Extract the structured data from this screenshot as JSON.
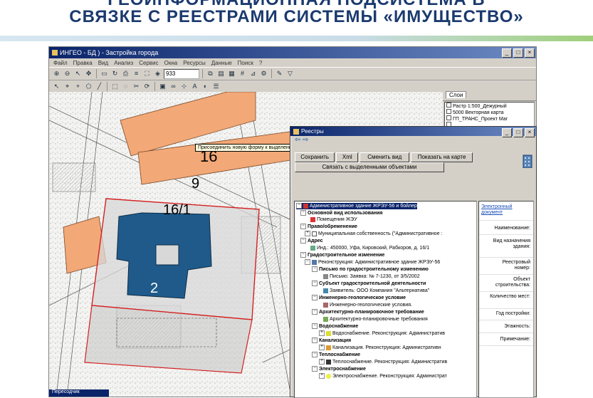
{
  "slide": {
    "title_line1": "ГЕОИНФОРМАЦИОННАЯ ПОДСИСТЕМА В",
    "title_line2": "СВЯЗКЕ С РЕЕСТРАМИ СИСТЕМЫ «ИМУЩЕСТВО»",
    "accent_color": "#1b3a6e"
  },
  "app": {
    "title": "ИНГЕО - БД                    ) - Застройка города",
    "menu": [
      "Файл",
      "Правка",
      "Вид",
      "Анализ",
      "Сервис",
      "Окна",
      "Ресурсы",
      "Данные",
      "Поиск",
      "?"
    ],
    "scale_value": "933",
    "tooltip": "Присоединить новую форму к выделенному объекту",
    "status_tab": "Пересодчик"
  },
  "layers": {
    "tab_label": "Слои",
    "items": [
      "Растр 1:500_Дежурный",
      "5000 Векторная карта",
      "ГП_ТРАНС_Проект Маг",
      "",
      "",
      ""
    ]
  },
  "map_labels": {
    "block_16": "16",
    "block_9": "9",
    "block_16_1": "16/1",
    "block_2": "2"
  },
  "registry": {
    "title": "Реестры",
    "buttons_row1": [
      "Сохранить",
      "Xml",
      "Сменить вид",
      "Показать на карте"
    ],
    "button_row2": "Связать с выделенными объектами",
    "tree": [
      {
        "level": 0,
        "text": "Административное здание ЖРЭУ-56 и бойлер",
        "bold": false,
        "highlight": true,
        "pm": "-"
      },
      {
        "level": 1,
        "text": "Основной вид использования",
        "bold": true,
        "pm": "-"
      },
      {
        "level": 2,
        "text": "Помещения ЖЭУ",
        "bold": false,
        "pm": ""
      },
      {
        "level": 1,
        "text": "Право/обременение",
        "bold": true,
        "pm": "-"
      },
      {
        "level": 2,
        "text": "Муниципальная собственность (\"Административное :",
        "bold": false,
        "pm": "+"
      },
      {
        "level": 1,
        "text": "Адрес",
        "bold": true,
        "pm": "-"
      },
      {
        "level": 2,
        "text": "Инд.: 450000, Уфа, Кировский, Рабкоров, д. 16/1",
        "bold": false,
        "pm": ""
      },
      {
        "level": 1,
        "text": "Градостроительное изменение",
        "bold": true,
        "pm": "-"
      },
      {
        "level": 2,
        "text": "Реконструкция: Административное здание ЖРЭУ-56",
        "bold": false,
        "pm": "-"
      },
      {
        "level": 3,
        "text": "Письмо по градостроительному изменению",
        "bold": true,
        "pm": "-"
      },
      {
        "level": 4,
        "text": "Письмо: Заявка: № 7-1230, от 3/5/2002",
        "bold": false,
        "pm": ""
      },
      {
        "level": 3,
        "text": "Субъект градостроительной деятельности",
        "bold": true,
        "pm": "-"
      },
      {
        "level": 4,
        "text": "Заявитель: ООО Компания \"Альтернатива\"",
        "bold": false,
        "pm": ""
      },
      {
        "level": 3,
        "text": "Инженерно-геологическое условие",
        "bold": true,
        "pm": "-"
      },
      {
        "level": 4,
        "text": "Инженерно-геологические условия.",
        "bold": false,
        "pm": ""
      },
      {
        "level": 3,
        "text": "Архитектурно-планировочное требование",
        "bold": true,
        "pm": "-"
      },
      {
        "level": 4,
        "text": "Архитектурно-планировочные требования",
        "bold": false,
        "pm": ""
      },
      {
        "level": 3,
        "text": "Водоснабжение",
        "bold": true,
        "pm": "-"
      },
      {
        "level": 4,
        "text": "Водоснабжение. Реконструкция: Административ",
        "bold": false,
        "pm": "+"
      },
      {
        "level": 3,
        "text": "Канализация",
        "bold": true,
        "pm": "-"
      },
      {
        "level": 4,
        "text": "Канализация. Реконструкция: Административн",
        "bold": false,
        "pm": "+"
      },
      {
        "level": 3,
        "text": "Теплоснабжение",
        "bold": true,
        "pm": "-"
      },
      {
        "level": 4,
        "text": "Теплоснабжение. Реконструкция: Административ",
        "bold": false,
        "pm": "+"
      },
      {
        "level": 3,
        "text": "Электроснабжение",
        "bold": true,
        "pm": "-"
      },
      {
        "level": 4,
        "text": "Электроснабжение. Реконструкция: Администрат",
        "bold": false,
        "pm": "+"
      }
    ],
    "props": {
      "link": "Электронный документ",
      "fields": [
        "Наименование:",
        "Вид назначения здания:",
        "Реестровый номер:",
        "Объект строительства:",
        "Количество мест:",
        "Год постройки:",
        "Этажность:",
        "Примечание:"
      ]
    }
  }
}
